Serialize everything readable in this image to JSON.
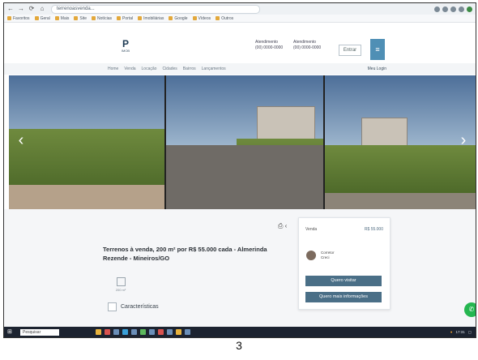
{
  "browser": {
    "url": "terrenoasvenda...",
    "nav": [
      "←",
      "→",
      "⟳",
      "⌂"
    ]
  },
  "bookmarks": [
    "Favoritos",
    "Geral",
    "Mais",
    "Site",
    "Notícias",
    "Portal",
    "Imobiliárias",
    "Google",
    "Vídeos",
    "Outros"
  ],
  "site": {
    "logo_mark": "P",
    "logo_text": "IMOB",
    "contact1_label": "Atendimento",
    "contact1_value": "(00) 0000-0000",
    "contact2_label": "Atendimento",
    "contact2_value": "(00) 0000-0000",
    "entrar": "Entrar",
    "menu_items": [
      "Home",
      "Venda",
      "Locação",
      "Cidades",
      "Bairros",
      "Lançamentos"
    ],
    "account": "Meu Login"
  },
  "property": {
    "title": "Terrenos à venda, 200 m² por R$ 55.000 cada - Almerinda Rezende - Mineiros/GO",
    "area_label": "200 m²",
    "characteristics": "Características",
    "card": {
      "sale_label": "Venda",
      "price": "R$ 55.000",
      "agent_name": "Corretor",
      "agent_sub": "Creci",
      "btn_visit": "Quero visitar",
      "btn_info": "Quero mais informações"
    }
  },
  "taskbar": {
    "search": "Pesquisar",
    "time": "17:31"
  },
  "page_caption": "3",
  "colors": {
    "accent": "#4a6f87",
    "whatsapp": "#25b650"
  }
}
